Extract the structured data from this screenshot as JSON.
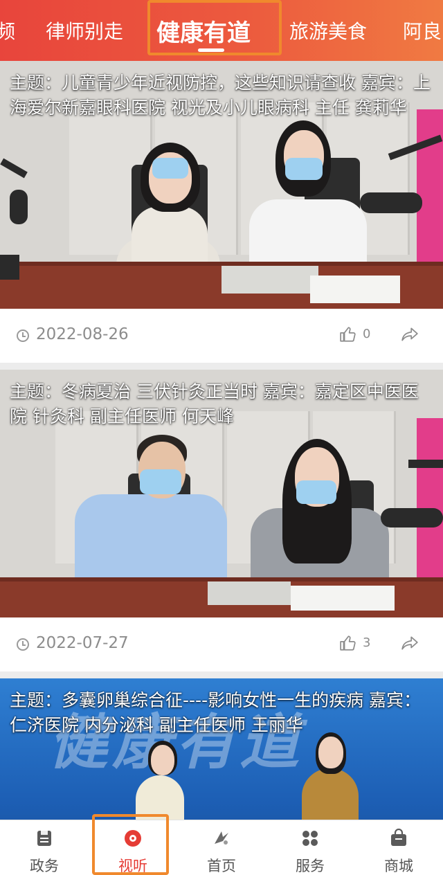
{
  "colors": {
    "brand": "#e8453c",
    "highlight": "#f0892d",
    "active": "#e53c35",
    "muted": "#8c8c8c"
  },
  "top_tabs": [
    {
      "label": "频",
      "active": false
    },
    {
      "label": "律师别走",
      "active": false
    },
    {
      "label": "健康有道",
      "active": true
    },
    {
      "label": "旅游美食",
      "active": false
    },
    {
      "label": "阿良",
      "active": false
    }
  ],
  "feed": [
    {
      "title": "主题：儿童青少年近视防控，这些知识请查收 嘉宾：上海爱尔新嘉眼科医院 视光及小儿眼病科 主任 龚莉华",
      "date": "2022-08-26",
      "likes": "0",
      "icons": {
        "date": "clock-icon",
        "like": "thumbs-up-icon",
        "share": "share-icon"
      }
    },
    {
      "title": "主题：冬病夏治 三伏针灸正当时 嘉宾：嘉定区中医医院 针灸科 副主任医师 何天峰",
      "date": "2022-07-27",
      "likes": "3",
      "icons": {
        "date": "clock-icon",
        "like": "thumbs-up-icon",
        "share": "share-icon"
      }
    },
    {
      "title": "主题：多囊卵巢综合征----影响女性一生的疾病 嘉宾：仁济医院 内分泌科 副主任医师 王丽华",
      "backdrop_text": "健康有道"
    }
  ],
  "bottom_nav": [
    {
      "label": "政务",
      "icon": "document-icon",
      "active": false
    },
    {
      "label": "视听",
      "icon": "play-disc-icon",
      "active": true
    },
    {
      "label": "首页",
      "icon": "home-logo-icon",
      "active": false
    },
    {
      "label": "服务",
      "icon": "grid-icon",
      "active": false
    },
    {
      "label": "商城",
      "icon": "shopping-bag-icon",
      "active": false
    }
  ]
}
